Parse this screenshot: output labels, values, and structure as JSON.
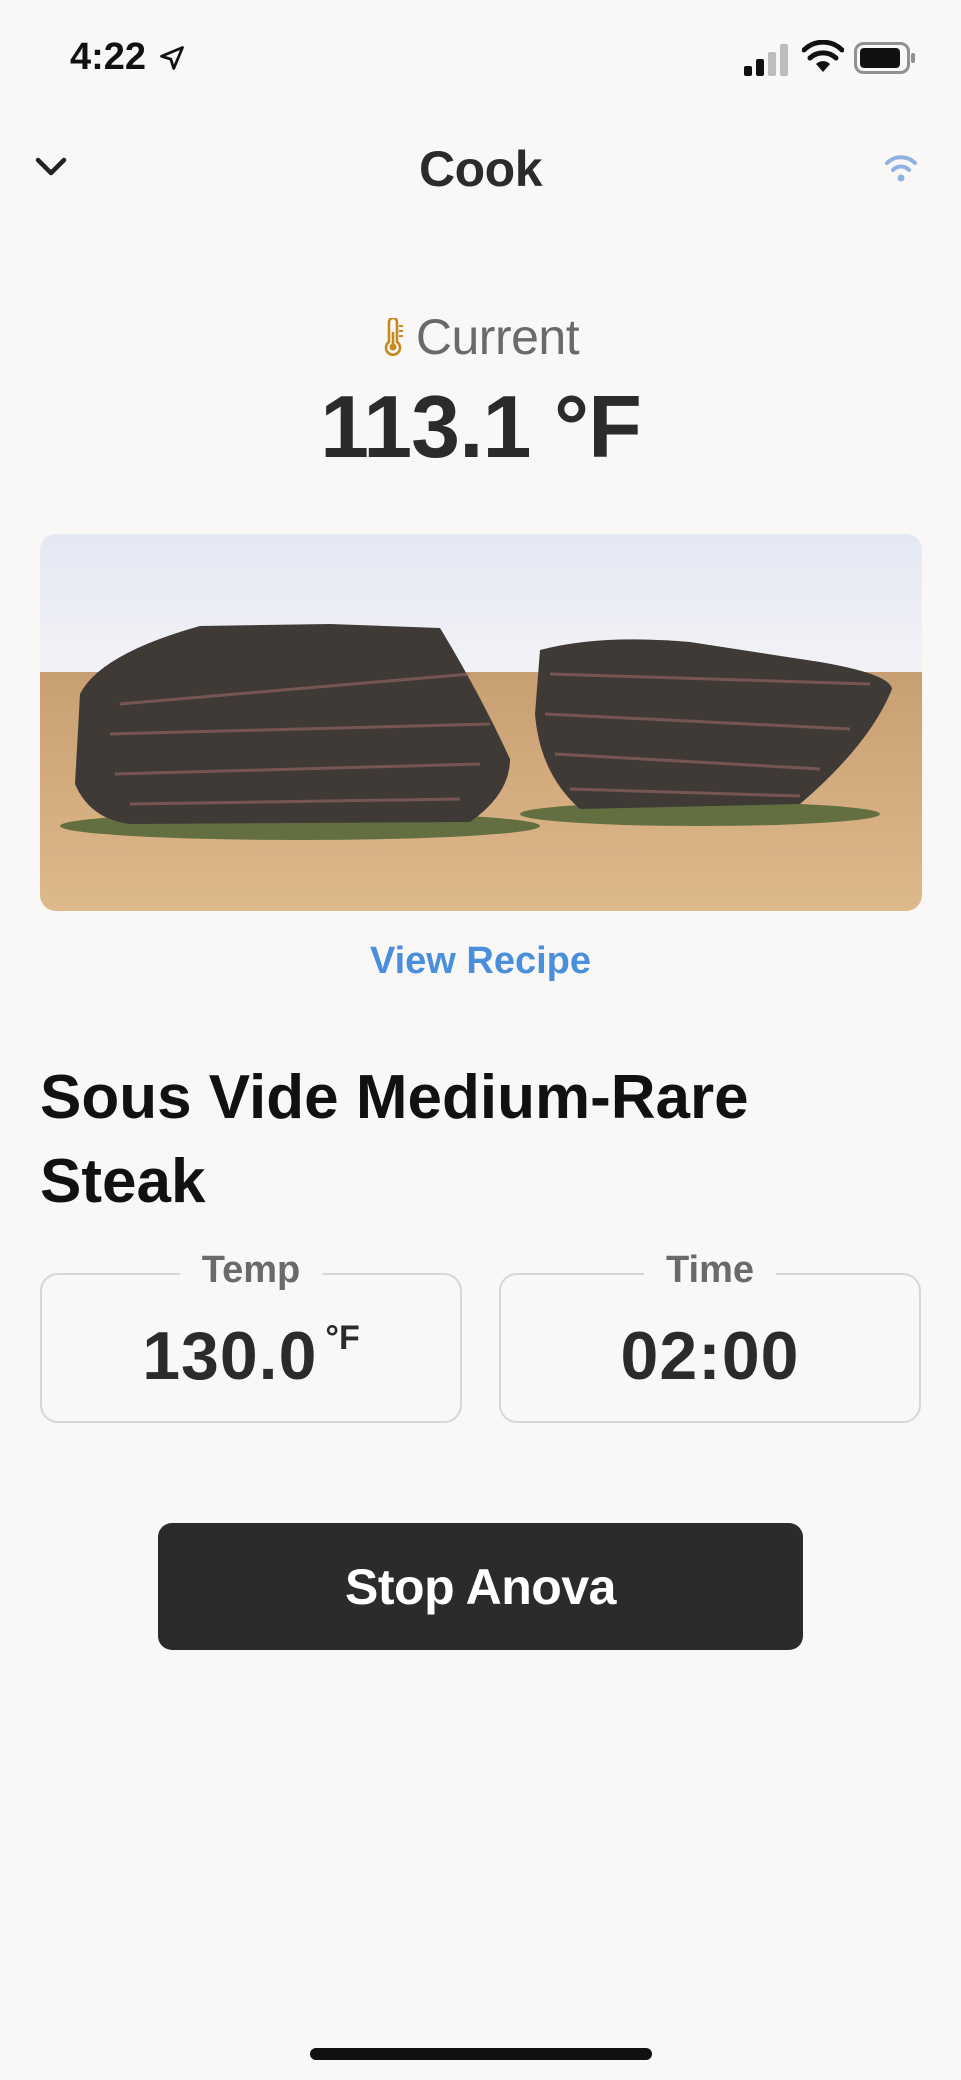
{
  "status_bar": {
    "time": "4:22",
    "location_icon": "location-arrow-icon",
    "signal_icon": "cellular-signal-icon",
    "wifi_icon": "wifi-icon",
    "battery_icon": "battery-icon"
  },
  "nav": {
    "back_icon": "chevron-down-icon",
    "title": "Cook",
    "connection_icon": "wifi-connection-icon",
    "connection_color": "#8fb2e3"
  },
  "current": {
    "icon": "thermometer-icon",
    "label": "Current",
    "value": "113.1 °F"
  },
  "recipe": {
    "image_alt": "steak-photo",
    "view_recipe_label": "View Recipe",
    "title": "Sous Vide Medium-Rare Steak"
  },
  "temp": {
    "label": "Temp",
    "value": "130.0",
    "unit": "°F"
  },
  "time": {
    "label": "Time",
    "value": "02:00"
  },
  "actions": {
    "stop_label": "Stop Anova"
  },
  "colors": {
    "accent": "#4a8fdc",
    "button_bg": "#2b2b2b",
    "background": "#f9f8f6",
    "thermometer": "#c48a1e"
  }
}
